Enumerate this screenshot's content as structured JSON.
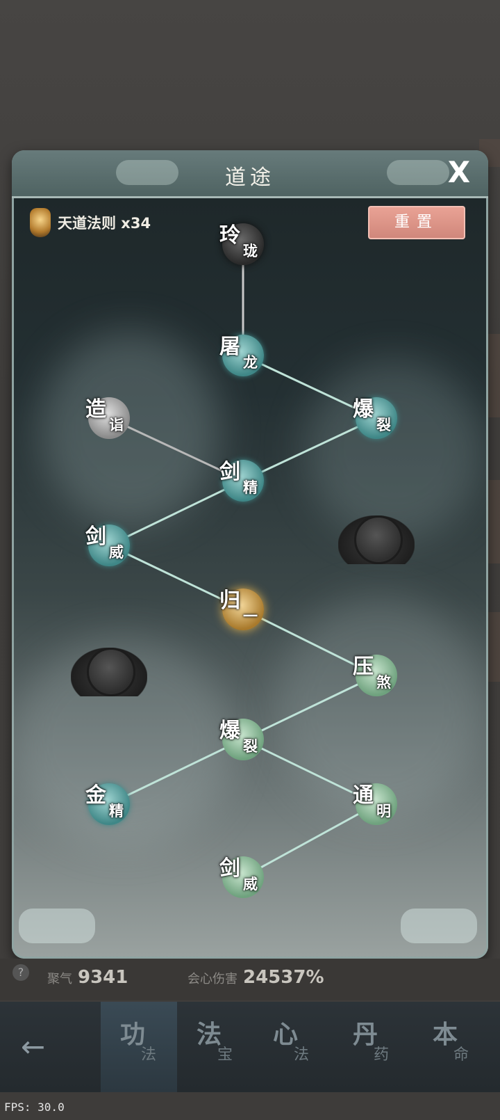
{
  "dialog": {
    "title": "道途",
    "close_label": "X",
    "currency_label": "天道法则 x34",
    "reset_label": "重置"
  },
  "tree": {
    "nodes": [
      {
        "id": "n1",
        "c1": "玲",
        "c2": "珑",
        "state": "dark"
      },
      {
        "id": "n2",
        "c1": "屠",
        "c2": "龙",
        "state": "teal"
      },
      {
        "id": "n3",
        "c1": "造",
        "c2": "诣",
        "state": "grey"
      },
      {
        "id": "n4",
        "c1": "爆",
        "c2": "裂",
        "state": "teal"
      },
      {
        "id": "n5",
        "c1": "剑",
        "c2": "精",
        "state": "teal"
      },
      {
        "id": "n6",
        "c1": "剑",
        "c2": "威",
        "state": "teal"
      },
      {
        "id": "n7",
        "c1": "归",
        "c2": "一",
        "state": "gold"
      },
      {
        "id": "n8",
        "c1": "压",
        "c2": "煞",
        "state": "green"
      },
      {
        "id": "n9",
        "c1": "爆",
        "c2": "裂",
        "state": "green"
      },
      {
        "id": "n10",
        "c1": "金",
        "c2": "精",
        "state": "teal"
      },
      {
        "id": "n11",
        "c1": "通",
        "c2": "明",
        "state": "green"
      },
      {
        "id": "n12",
        "c1": "剑",
        "c2": "威",
        "state": "green"
      }
    ],
    "locked_count": 2
  },
  "stats": {
    "help": "?",
    "qi_label": "聚气",
    "qi_value": "9341",
    "crit_label": "会心伤害",
    "crit_value": "24537%"
  },
  "nav": {
    "back_icon": "left-arrow-icon",
    "tabs": [
      {
        "t1": "功",
        "t2": "法"
      },
      {
        "t1": "法",
        "t2": "宝"
      },
      {
        "t1": "心",
        "t2": "法"
      },
      {
        "t1": "丹",
        "t2": "药"
      },
      {
        "t1": "本",
        "t2": "命"
      }
    ]
  },
  "fps": "FPS: 30.0",
  "colors": {
    "teal": "#5fa7a8",
    "green": "#8fbf9a",
    "gold": "#d6a94e",
    "dark": "#3a3a3a",
    "grey": "#9a9a9a",
    "line_active": "#bfe3d8",
    "line_inactive": "#b0b0b0"
  }
}
